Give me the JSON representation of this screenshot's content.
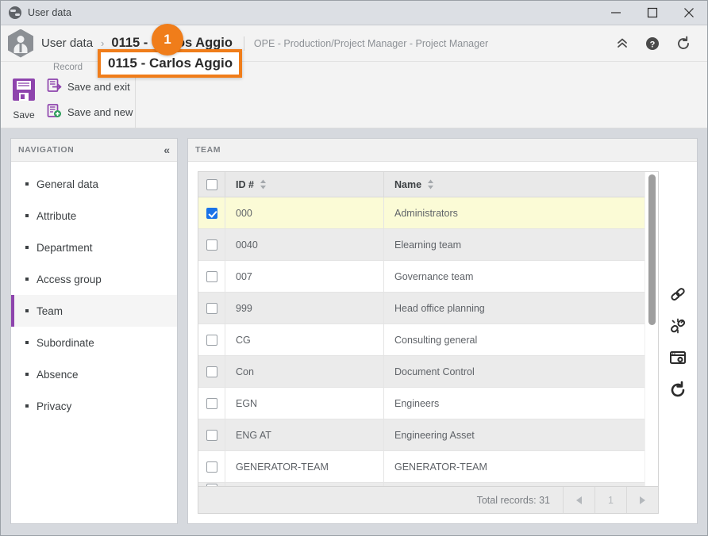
{
  "window": {
    "title": "User data",
    "icon": "globe-icon",
    "controls": {
      "minimize": "minimize-icon",
      "maximize": "maximize-icon",
      "close": "close-icon"
    }
  },
  "header": {
    "avatar_icon": "user-hex-avatar-icon",
    "breadcrumb_root": "User data",
    "breadcrumb_separator": "›",
    "breadcrumb_current": "0115 - Carlos Aggio",
    "subtitle": "OPE - Production/Project Manager - Project Manager",
    "icons": [
      "chevron-up-icon",
      "help-icon",
      "refresh-icon"
    ]
  },
  "annotation": {
    "number": "1",
    "color": "#f07d1a",
    "target": "0115 - Carlos Aggio"
  },
  "ribbon": {
    "group_label": "Record",
    "save_label": "Save",
    "save_and_exit_label": "Save and exit",
    "save_and_new_label": "Save and new",
    "accent_color": "#8e44ad"
  },
  "navigation": {
    "panel_title": "NAVIGATION",
    "collapse_icon": "double-chevron-left-icon",
    "active": "Team",
    "items": [
      {
        "label": "General data"
      },
      {
        "label": "Attribute"
      },
      {
        "label": "Department"
      },
      {
        "label": "Access group"
      },
      {
        "label": "Team"
      },
      {
        "label": "Subordinate"
      },
      {
        "label": "Absence"
      },
      {
        "label": "Privacy"
      }
    ]
  },
  "content": {
    "panel_title": "TEAM",
    "columns": [
      {
        "label": "ID #"
      },
      {
        "label": "Name"
      }
    ],
    "rows": [
      {
        "id": "000",
        "name": "Administrators",
        "checked": true,
        "style": "row-sel"
      },
      {
        "id": "0040",
        "name": "Elearning team",
        "checked": false,
        "style": "row-alt"
      },
      {
        "id": "007",
        "name": "Governance team",
        "checked": false,
        "style": "row-plain"
      },
      {
        "id": "999",
        "name": "Head office planning",
        "checked": false,
        "style": "row-alt"
      },
      {
        "id": "CG",
        "name": "Consulting general",
        "checked": false,
        "style": "row-plain"
      },
      {
        "id": "Con",
        "name": "Document Control",
        "checked": false,
        "style": "row-alt"
      },
      {
        "id": "EGN",
        "name": "Engineers",
        "checked": false,
        "style": "row-plain"
      },
      {
        "id": "ENG AT",
        "name": "Engineering Asset",
        "checked": false,
        "style": "row-alt"
      },
      {
        "id": "GENERATOR-TEAM",
        "name": "GENERATOR-TEAM",
        "checked": false,
        "style": "row-plain"
      }
    ],
    "footer": {
      "total_records": "Total records: 31",
      "page": "1",
      "prev_icon": "prev-page-icon",
      "next_icon": "next-page-icon"
    },
    "side_tools": [
      "link-icon",
      "unlink-icon",
      "preview-window-icon",
      "refresh-icon"
    ]
  }
}
